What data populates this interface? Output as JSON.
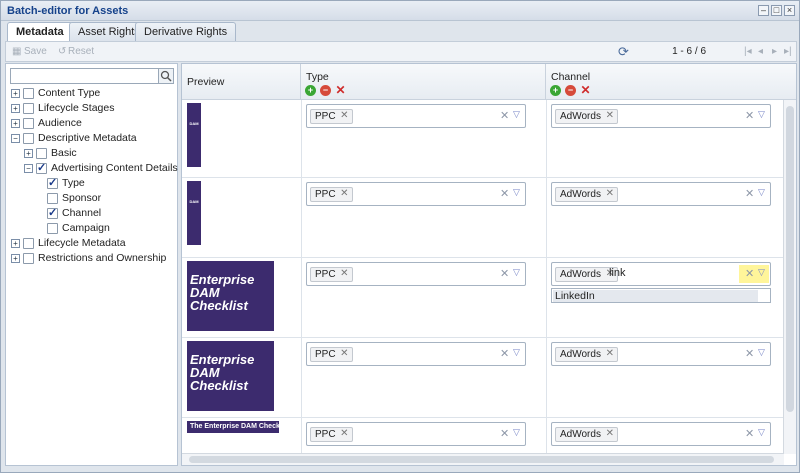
{
  "window": {
    "title": "Batch-editor for Assets"
  },
  "tabs": [
    "Metadata",
    "Asset Rights",
    "Derivative Rights"
  ],
  "toolbar": {
    "save_label": "Save",
    "reset_label": "Reset",
    "pager_text": "1 - 6 / 6"
  },
  "tree": {
    "search_placeholder": "",
    "items": [
      {
        "label": "Content Type",
        "checked": false,
        "expander": "+",
        "level": 0
      },
      {
        "label": "Lifecycle Stages",
        "checked": false,
        "expander": "+",
        "level": 0
      },
      {
        "label": "Audience",
        "checked": false,
        "expander": "+",
        "level": 0
      },
      {
        "label": "Descriptive Metadata",
        "checked": false,
        "expander": "−",
        "level": 0
      },
      {
        "label": "Basic",
        "checked": false,
        "expander": "+",
        "level": 1
      },
      {
        "label": "Advertising Content Details",
        "checked": true,
        "expander": "−",
        "level": 1
      },
      {
        "label": "Type",
        "checked": true,
        "expander": "",
        "level": 2
      },
      {
        "label": "Sponsor",
        "checked": false,
        "expander": "",
        "level": 2
      },
      {
        "label": "Channel",
        "checked": true,
        "expander": "",
        "level": 2
      },
      {
        "label": "Campaign",
        "checked": false,
        "expander": "",
        "level": 2
      },
      {
        "label": "Lifecycle Metadata",
        "checked": false,
        "expander": "+",
        "level": 0
      },
      {
        "label": "Restrictions and Ownership",
        "checked": false,
        "expander": "+",
        "level": 0
      }
    ]
  },
  "grid": {
    "columns": [
      "Preview",
      "Type",
      "Channel"
    ],
    "rows": [
      {
        "type": "PPC",
        "channel": "AdWords",
        "thumb_text": "DAM"
      },
      {
        "type": "PPC",
        "channel": "AdWords",
        "thumb_text": "DAM"
      },
      {
        "type": "PPC",
        "channel": "AdWords",
        "channel_input": "link",
        "thumb_text": "Enterprise DAM Checklist"
      },
      {
        "type": "PPC",
        "channel": "AdWords",
        "thumb_text": "Enterprise DAM Checklist"
      },
      {
        "type": "PPC",
        "channel": "AdWords",
        "thumb_text": "The Enterprise DAM Checklist"
      }
    ],
    "dropdown": {
      "option": "LinkedIn"
    }
  },
  "colors": {
    "add": "#3aa634",
    "remove": "#d64a3a",
    "clear": "#cf2b2b",
    "thumb": "#3c2b6e",
    "highlight": "#fff59a"
  }
}
